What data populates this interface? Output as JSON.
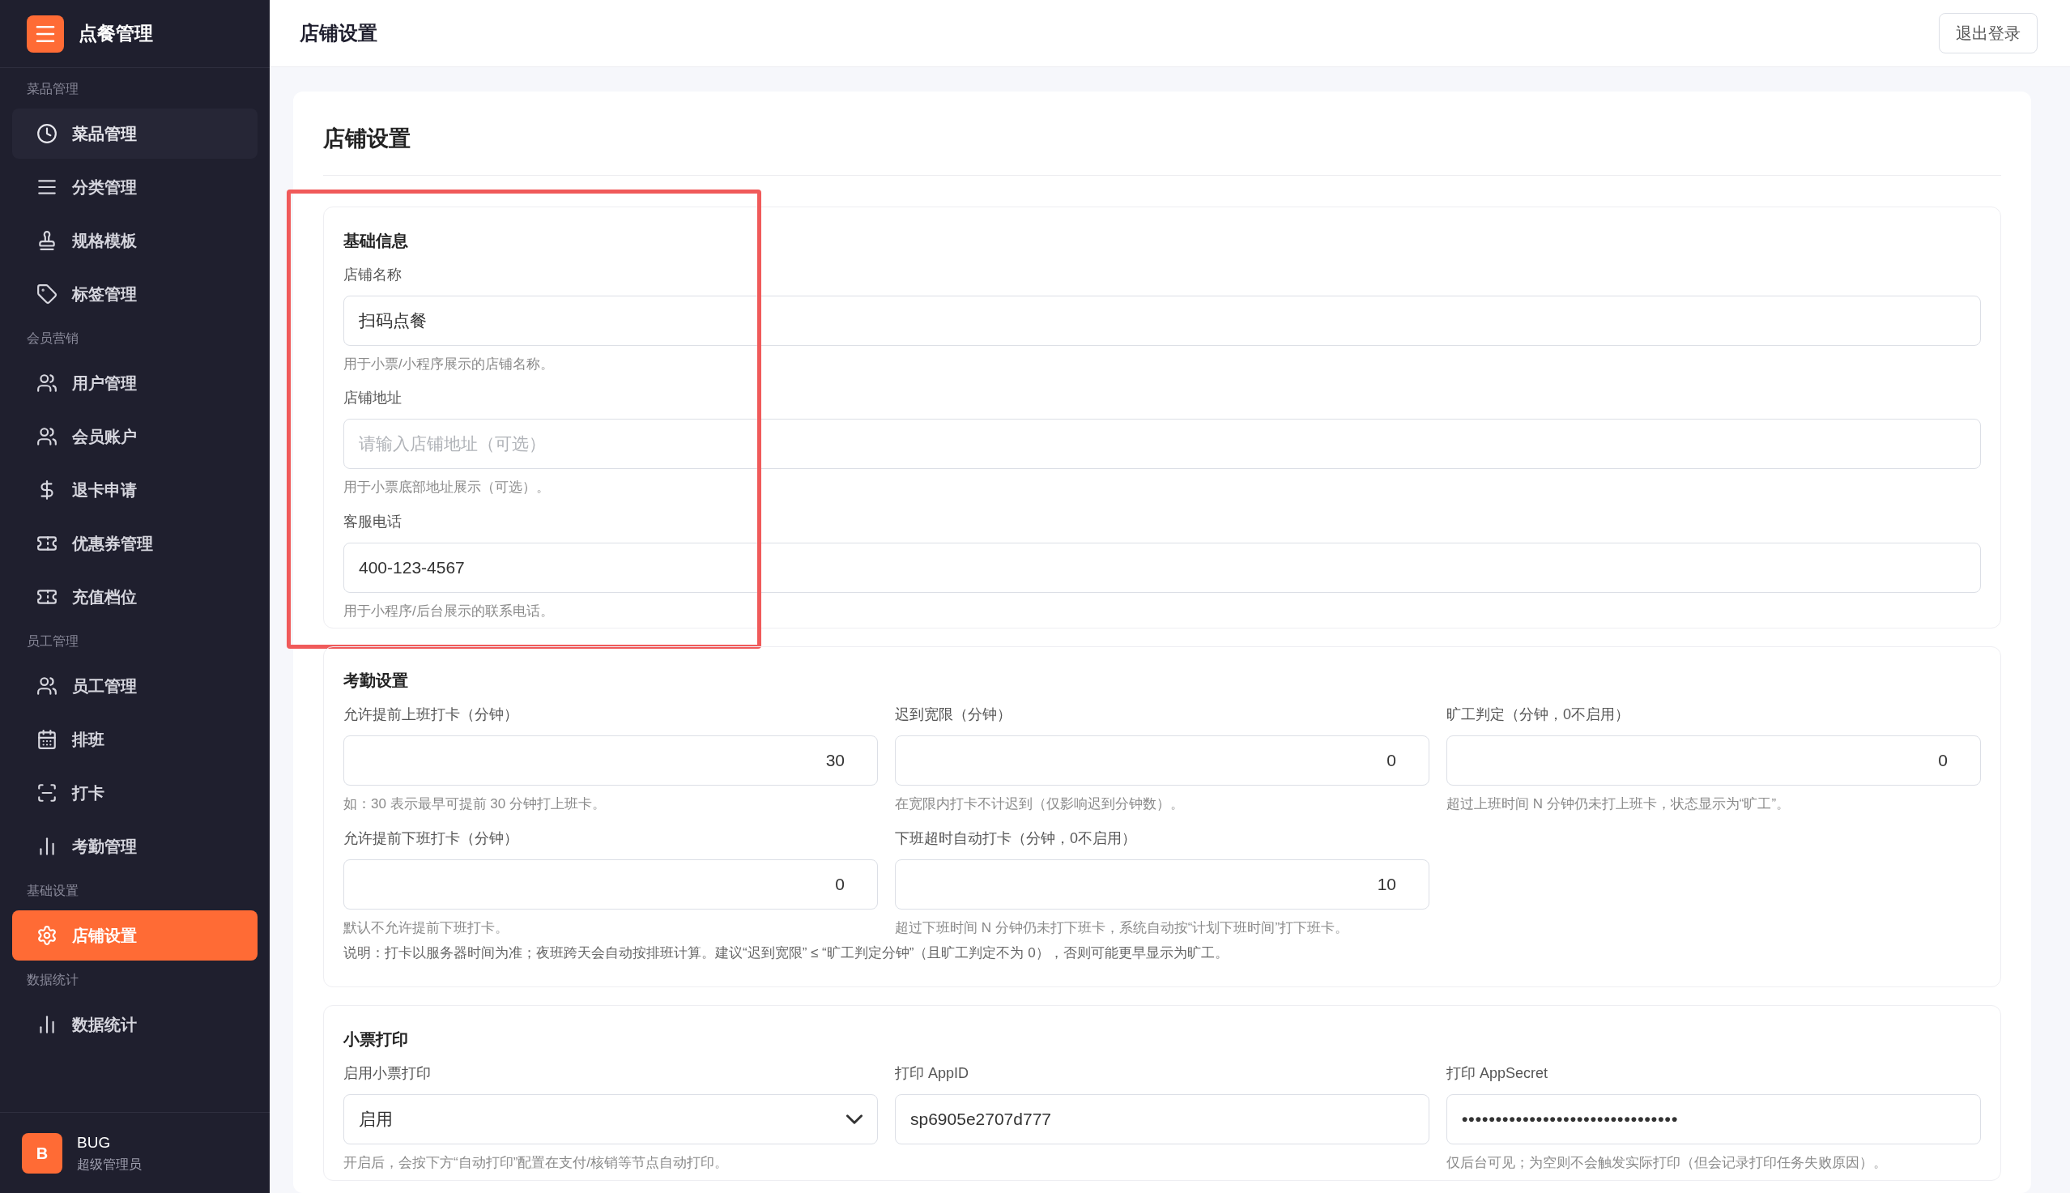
{
  "app": {
    "title": "点餐管理"
  },
  "sidebar": {
    "groups": [
      {
        "label": "菜品管理",
        "items": [
          {
            "label": "菜品管理",
            "selected": false,
            "hovered": true
          },
          {
            "label": "分类管理",
            "selected": false,
            "hovered": false
          },
          {
            "label": "规格模板",
            "selected": false,
            "hovered": false
          },
          {
            "label": "标签管理",
            "selected": false,
            "hovered": false
          }
        ]
      },
      {
        "label": "会员营销",
        "items": [
          {
            "label": "用户管理",
            "selected": false,
            "hovered": false
          },
          {
            "label": "会员账户",
            "selected": false,
            "hovered": false
          },
          {
            "label": "退卡申请",
            "selected": false,
            "hovered": false
          },
          {
            "label": "优惠券管理",
            "selected": false,
            "hovered": false
          },
          {
            "label": "充值档位",
            "selected": false,
            "hovered": false
          }
        ]
      },
      {
        "label": "员工管理",
        "items": [
          {
            "label": "员工管理",
            "selected": false,
            "hovered": false
          },
          {
            "label": "排班",
            "selected": false,
            "hovered": false
          },
          {
            "label": "打卡",
            "selected": false,
            "hovered": false
          },
          {
            "label": "考勤管理",
            "selected": false,
            "hovered": false
          }
        ]
      },
      {
        "label": "基础设置",
        "items": [
          {
            "label": "店铺设置",
            "selected": true,
            "hovered": false
          }
        ]
      },
      {
        "label": "数据统计",
        "items": [
          {
            "label": "数据统计",
            "selected": false,
            "hovered": false
          }
        ]
      }
    ],
    "user": {
      "avatar": "B",
      "name": "BUG",
      "role": "超级管理员"
    }
  },
  "header": {
    "title": "店铺设置",
    "logout": "退出登录"
  },
  "page": {
    "title": "店铺设置",
    "sections": [
      {
        "title": "基础信息",
        "kind": "stack",
        "highlighted": true,
        "rows": [
          [
            {
              "kind": "text",
              "label": "店铺名称",
              "value": "扫码点餐",
              "hint": "用于小票/小程序展示的店铺名称。"
            }
          ],
          [
            {
              "kind": "text",
              "label": "店铺地址",
              "placeholder": "请输入店铺地址（可选）",
              "hint": "用于小票底部地址展示（可选）。"
            }
          ],
          [
            {
              "kind": "text",
              "label": "客服电话",
              "value": "400-123-4567",
              "hint": "用于小程序/后台展示的联系电话。"
            }
          ]
        ]
      },
      {
        "title": "考勤设置",
        "kind": "grid",
        "highlighted": false,
        "rows": [
          [
            {
              "kind": "number",
              "label": "允许提前上班打卡（分钟）",
              "value": "30",
              "hint": "如：30 表示最早可提前 30 分钟打上班卡。"
            },
            {
              "kind": "number",
              "label": "迟到宽限（分钟）",
              "value": "0",
              "hint": "在宽限内打卡不计迟到（仅影响迟到分钟数）。"
            },
            {
              "kind": "number",
              "label": "旷工判定（分钟，0不启用）",
              "value": "0",
              "hint": "超过上班时间 N 分钟仍未打上班卡，状态显示为“旷工”。"
            }
          ],
          [
            {
              "kind": "number",
              "label": "允许提前下班打卡（分钟）",
              "value": "0",
              "hint": "默认不允许提前下班打卡。"
            },
            {
              "kind": "number",
              "label": "下班超时自动打卡（分钟，0不启用）",
              "value": "10",
              "hint": "超过下班时间 N 分钟仍未打下班卡，系统自动按“计划下班时间”打下班卡。"
            }
          ]
        ],
        "note": "说明：打卡以服务器时间为准；夜班跨天会自动按排班计算。建议“迟到宽限” ≤ “旷工判定分钟”（且旷工判定不为 0），否则可能更早显示为旷工。"
      },
      {
        "title": "小票打印",
        "kind": "grid",
        "highlighted": false,
        "rows": [
          [
            {
              "kind": "select",
              "label": "启用小票打印",
              "value": "启用",
              "hint": "开启后，会按下方“自动打印”配置在支付/核销等节点自动打印。"
            },
            {
              "kind": "text",
              "label": "打印 AppID",
              "value": "sp6905e2707d777"
            },
            {
              "kind": "password",
              "label": "打印 AppSecret",
              "value": "••••••••••••••••••••••••••••••••",
              "hint": "仅后台可见；为空则不会触发实际打印（但会记录打印任务失败原因）。"
            }
          ]
        ]
      }
    ]
  }
}
